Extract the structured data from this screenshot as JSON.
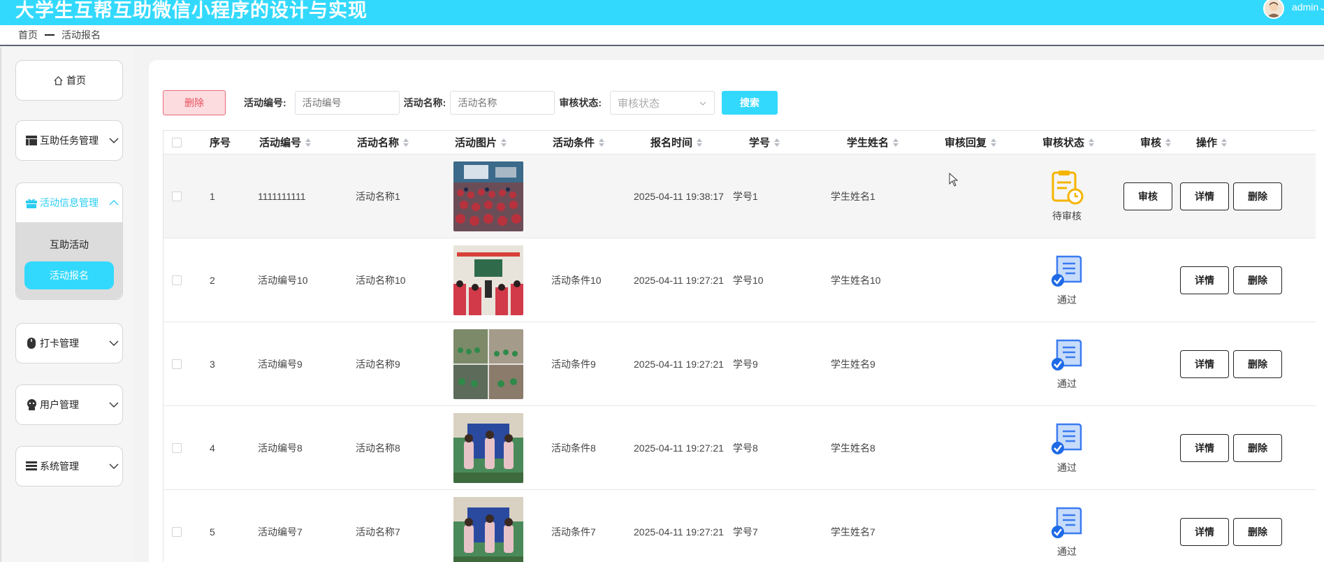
{
  "header": {
    "title": "大学生互帮互助微信小程序的设计与实现",
    "user": "admin"
  },
  "breadcrumb": {
    "home": "首页",
    "current": "活动报名"
  },
  "sidebar": {
    "home": "首页",
    "menus": [
      {
        "label": "互助任务管理",
        "icon": "table-icon"
      },
      {
        "label": "活动信息管理",
        "icon": "gift-icon",
        "active": true,
        "items": [
          {
            "label": "互助活动"
          },
          {
            "label": "活动报名",
            "active": true
          }
        ]
      },
      {
        "label": "打卡管理",
        "icon": "mouse-icon"
      },
      {
        "label": "用户管理",
        "icon": "user-icon"
      },
      {
        "label": "系统管理",
        "icon": "list-icon"
      }
    ]
  },
  "toolbar": {
    "delete": "删除",
    "activity_no_label": "活动编号:",
    "activity_no_placeholder": "活动编号",
    "activity_name_label": "活动名称:",
    "activity_name_placeholder": "活动名称",
    "status_label": "审核状态:",
    "status_placeholder": "审核状态",
    "search": "搜索"
  },
  "table": {
    "columns": [
      "序号",
      "活动编号",
      "活动名称",
      "活动图片",
      "活动条件",
      "报名时间",
      "学号",
      "学生姓名",
      "审核回复",
      "审核状态",
      "审核",
      "操作"
    ],
    "rows": [
      {
        "index": "1",
        "activity_no": "1111111111",
        "activity_name": "活动名称1",
        "condition": "",
        "time": "2025-04-11 19:38:17",
        "student_no": "学号1",
        "student_name": "学生姓名1",
        "reply": "",
        "status": "待审核",
        "status_type": "pending",
        "review": "审核",
        "detail": "详情",
        "delete": "删除"
      },
      {
        "index": "2",
        "activity_no": "活动编号10",
        "activity_name": "活动名称10",
        "condition": "活动条件10",
        "time": "2025-04-11 19:27:21",
        "student_no": "学号10",
        "student_name": "学生姓名10",
        "reply": "",
        "status": "通过",
        "status_type": "passed",
        "review": "",
        "detail": "详情",
        "delete": "删除"
      },
      {
        "index": "3",
        "activity_no": "活动编号9",
        "activity_name": "活动名称9",
        "condition": "活动条件9",
        "time": "2025-04-11 19:27:21",
        "student_no": "学号9",
        "student_name": "学生姓名9",
        "reply": "",
        "status": "通过",
        "status_type": "passed",
        "review": "",
        "detail": "详情",
        "delete": "删除"
      },
      {
        "index": "4",
        "activity_no": "活动编号8",
        "activity_name": "活动名称8",
        "condition": "活动条件8",
        "time": "2025-04-11 19:27:21",
        "student_no": "学号8",
        "student_name": "学生姓名8",
        "reply": "",
        "status": "通过",
        "status_type": "passed",
        "review": "",
        "detail": "详情",
        "delete": "删除"
      },
      {
        "index": "5",
        "activity_no": "活动编号7",
        "activity_name": "活动名称7",
        "condition": "活动条件7",
        "time": "2025-04-11 19:27:21",
        "student_no": "学号7",
        "student_name": "学生姓名7",
        "reply": "",
        "status": "通过",
        "status_type": "passed",
        "review": "",
        "detail": "详情",
        "delete": "删除"
      }
    ]
  },
  "colors": {
    "accent": "#33d9fd",
    "danger": "#e8505f",
    "pending": "#f5b400",
    "passed": "#3a7bf0"
  }
}
